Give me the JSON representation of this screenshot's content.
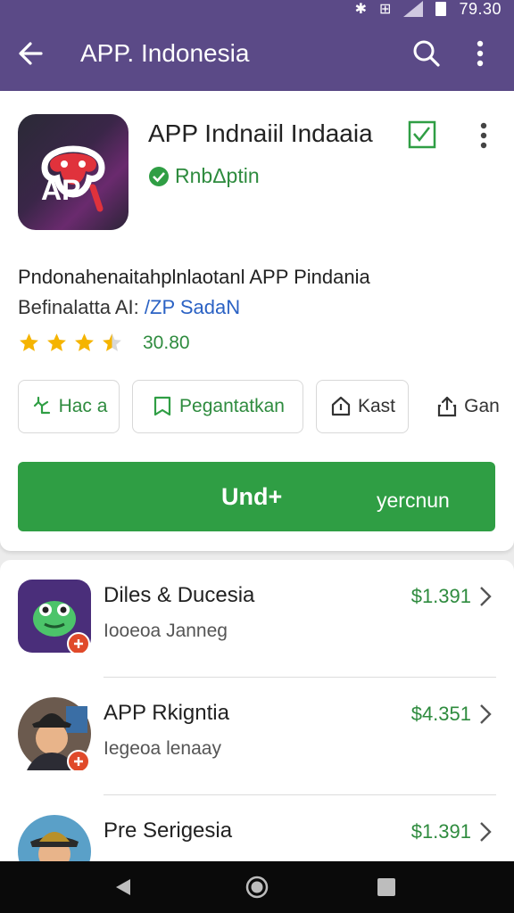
{
  "status_bar": {
    "time": "79.30"
  },
  "app_bar": {
    "title": "APP. Indonesia",
    "icons": [
      "back-arrow-icon",
      "search-icon",
      "more-vert-icon"
    ]
  },
  "app": {
    "name": "APP Indnaiil Indaaia",
    "icon_text": "AP",
    "verified_label": "RnbΔptin",
    "description_line1": "Pndonahenaitahplnlaotanl APP Pindania",
    "description_line2_prefix": "Befinalatta AI:",
    "description_line2_link": "/ZP SadaN",
    "rating": 3.5,
    "rating_text": "30.80",
    "accent_color": "#2f9e44",
    "brand_color": "#5b4a87"
  },
  "actions": [
    {
      "label": "Hac a",
      "icon": "like-hand-icon"
    },
    {
      "label": "Pegantatkan",
      "icon": "bookmark-outline-icon"
    },
    {
      "label": "Kast",
      "icon": "list-tag-icon"
    },
    {
      "label": "Gan",
      "icon": "share-icon"
    }
  ],
  "install": {
    "label": "Und+",
    "sub_label": "yercnun"
  },
  "list": [
    {
      "title": "Diles & Ducesia",
      "subtitle": "Iooeoa Janneg",
      "price": "$1.391"
    },
    {
      "title": "APP Rkigntia",
      "subtitle": "Iegeoa lenaay",
      "price": "$4.351"
    },
    {
      "title": "Pre Serigesia",
      "subtitle": "",
      "price": "$1.391"
    }
  ],
  "nav": {
    "icons": [
      "nav-back-icon",
      "nav-home-icon",
      "nav-recents-icon"
    ]
  }
}
